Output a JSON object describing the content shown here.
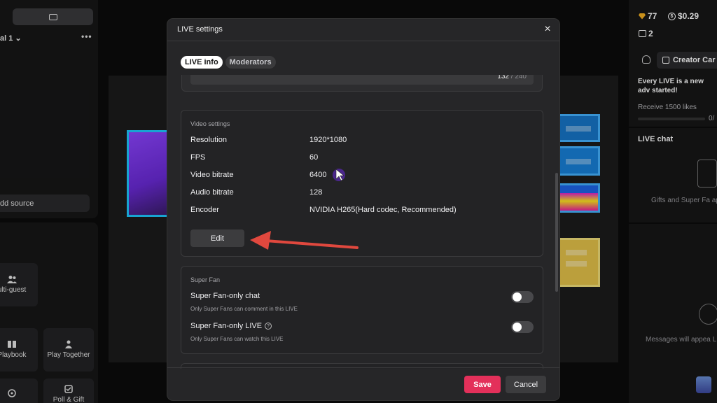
{
  "left_panel": {
    "scene_name": "al 1",
    "scene_menu": "•••",
    "add_source_label": "dd source",
    "tools": {
      "multi_guest": "ulti-guest",
      "playbook": "Playbook",
      "play_together": "Play Together",
      "poll_gift": "Poll & Gift"
    }
  },
  "right_panel": {
    "diamonds": "77",
    "money": "$0.29",
    "gifts": "2",
    "creator_button": "Creator Car",
    "adventure_text": "Every LIVE is a new adv started!",
    "receive_likes": "Receive 1500 likes",
    "receive_count": "0/",
    "chat_title": "LIVE chat",
    "gifts_text": "Gifts and Super Fa appea",
    "messages_text": "Messages will appea LIV"
  },
  "modal": {
    "title": "LIVE settings",
    "close_icon": "×",
    "tabs": [
      {
        "label": "LIVE info",
        "active": true
      },
      {
        "label": "Moderators",
        "active": false
      }
    ],
    "char_count": {
      "current": "132",
      "separator": " / ",
      "max": "240"
    },
    "video_settings": {
      "section_label": "Video settings",
      "rows": [
        {
          "label": "Resolution",
          "value": "1920*1080"
        },
        {
          "label": "FPS",
          "value": "60"
        },
        {
          "label": "Video bitrate",
          "value": "6400"
        },
        {
          "label": "Audio bitrate",
          "value": "128"
        },
        {
          "label": "Encoder",
          "value": "NVIDIA H265(Hard codec, Recommended)"
        }
      ],
      "edit_label": "Edit"
    },
    "super_fan": {
      "section_label": "Super Fan",
      "items": [
        {
          "title": "Super Fan-only chat",
          "subtitle": "Only Super Fans can comment in this LIVE",
          "enabled": false
        },
        {
          "title": "Super Fan-only LIVE",
          "subtitle": "Only Super Fans can watch this LIVE",
          "enabled": false
        }
      ]
    },
    "save_label": "Save",
    "cancel_label": "Cancel"
  },
  "colors": {
    "accent_save": "#e3305a",
    "annotation_arrow": "#e0483e",
    "cursor": "#7a3fe0"
  }
}
